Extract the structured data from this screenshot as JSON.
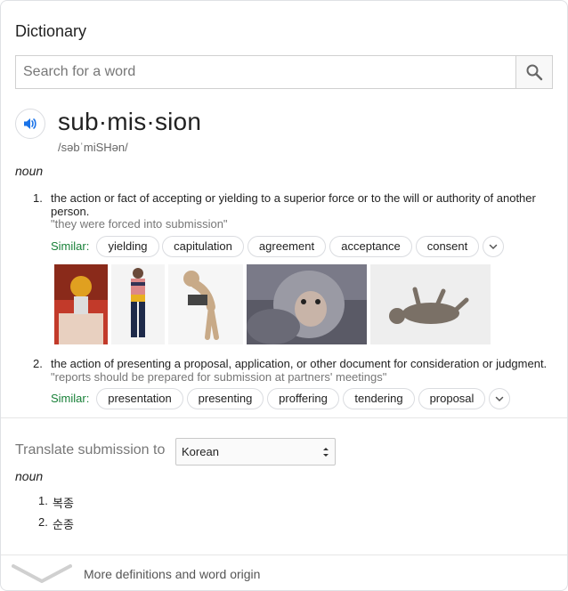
{
  "header": {
    "title": "Dictionary"
  },
  "search": {
    "placeholder": "Search for a word",
    "value": ""
  },
  "entry": {
    "headword": "sub·mis·sion",
    "pronunciation": "/səbˈmiSHən/",
    "part_of_speech": "noun"
  },
  "definitions": [
    {
      "number": "1.",
      "text": "the action or fact of accepting or yielding to a superior force or to the will or authority of another person.",
      "example": "\"they were forced into submission\"",
      "similar_label": "Similar:",
      "similar": [
        "yielding",
        "capitulation",
        "agreement",
        "acceptance",
        "consent"
      ]
    },
    {
      "number": "2.",
      "text": "the action of presenting a proposal, application, or other document for consideration or judgment.",
      "example": "\"reports should be prepared for submission at partners' meetings\"",
      "similar_label": "Similar:",
      "similar": [
        "presentation",
        "presenting",
        "proffering",
        "tendering",
        "proposal"
      ]
    }
  ],
  "images": [
    {
      "name": "submission-image-1",
      "icon": "photo-person-mask"
    },
    {
      "name": "submission-image-2",
      "icon": "photo-person-standing"
    },
    {
      "name": "submission-image-3",
      "icon": "photo-bowing-figure"
    },
    {
      "name": "submission-image-4",
      "icon": "photo-monkey"
    },
    {
      "name": "submission-image-5",
      "icon": "photo-dog-on-back"
    }
  ],
  "translate": {
    "label": "Translate submission to",
    "language": "Korean",
    "part_of_speech": "noun",
    "items": [
      {
        "number": "1.",
        "word": "복종"
      },
      {
        "number": "2.",
        "word": "순종"
      }
    ]
  },
  "footer": {
    "more_label": "More definitions and word origin"
  },
  "colors": {
    "accent_blue": "#1a73e8",
    "similar_green": "#188038",
    "border": "#dadce0"
  }
}
